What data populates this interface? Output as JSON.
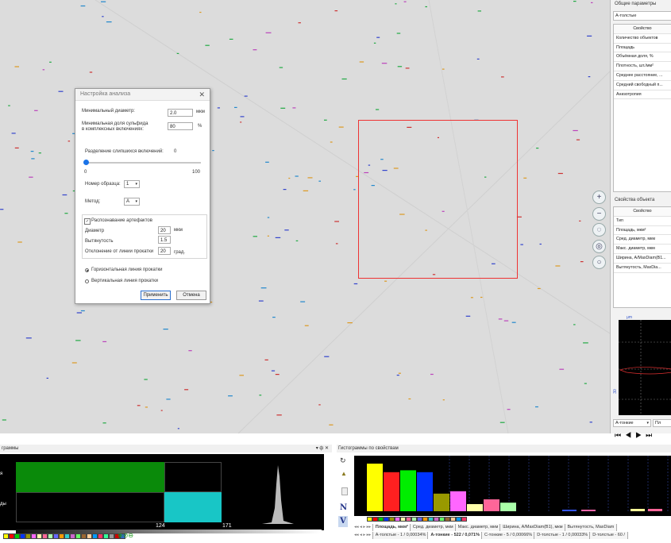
{
  "dialog": {
    "title": "Настройка анализа",
    "min_diameter_label": "Минимальный диаметр:",
    "min_diameter_value": "2.0",
    "min_diameter_unit": "мкм",
    "min_sulfide_label_1": "Минимальная доля сульфида",
    "min_sulfide_label_2": "в комплексных включениях:",
    "min_sulfide_value": "80",
    "min_sulfide_unit": "%",
    "split_label": "Разделение слипшихся включений:",
    "split_value": "0",
    "slider_min": "0",
    "slider_max": "100",
    "slider_fraction": 0.0,
    "sample_label": "Номер образца:",
    "sample_value": "1",
    "method_label": "Метод:",
    "method_value": "A",
    "artifacts_label": "Распознавание артефактов",
    "artifacts_checked": true,
    "diameter_label": "Диаметр",
    "diameter_value": "20",
    "diameter_unit": "мкм",
    "elong_label": "Вытянутость",
    "elong_value": "1.5",
    "deviation_label": "Отклонение от линии прокатки",
    "deviation_value": "20",
    "deviation_unit": "град.",
    "radio_horizontal": "Горизонтальная линия прокатки",
    "radio_vertical": "Вертикальная линия прокатки",
    "apply": "Применить",
    "cancel": "Отмена"
  },
  "right_panel": {
    "general_title": "Общие параметры",
    "category": "А-толстые",
    "table_header": "Свойство",
    "general_rows": [
      "Количество объектов",
      "Площадь",
      "Объёмная доля, %",
      "Плотность, шт./мм²",
      "Среднее расстояние, ...",
      "Средний свободный п...",
      "Анизотропия"
    ],
    "object_title": "Свойства объекта",
    "object_header": "Свойство",
    "object_rows": [
      "Тип",
      "Площадь, мкм²",
      "Сред. диаметр, мкм",
      "Макс. диаметр, мкм",
      "Ширина, A/MaxDiam(B1...",
      "Вытянутость, MaxDia..."
    ],
    "plot_axis_label": "μm",
    "plot_tick": "30",
    "dropdown_value": "А-тонкие",
    "dropdown2_value": "Пл"
  },
  "bottom_left": {
    "title": "граммы",
    "label_a": "я",
    "label_b": "ды",
    "tick1": "124",
    "tick2": "171",
    "pin": "▾ ф ✕"
  },
  "bottom_right": {
    "title": "Гистограммы по свойствам",
    "tabs_top": [
      "Площадь, мкм²",
      "Сред. диаметр, мкм",
      "Макс. диаметр, мкм",
      "Ширина, A/MaxDiam(B1), мкм",
      "Вытянутость, MaxDiam"
    ],
    "tabs_bottom": [
      "А-толстые - 1 / 0,00034%",
      "А-тонкие - 522 / 0,071%",
      "С-тонкие - 5 / 0,00066%",
      "D-толстые - 1 / 0,00033%",
      "D-толстые - 60 /"
    ],
    "tool_n": "N",
    "tool_v": "V"
  },
  "colors": {
    "roi": "#ee3333",
    "hist_green": "#0a8a0a",
    "hist_cyan": "#18c6c6",
    "bar_yellow": "#ffff00",
    "bar_red": "#ff0000",
    "bar_green": "#00ff00",
    "bar_blue": "#0033ff"
  },
  "histogram_bars": [
    {
      "color": "#ffff00",
      "value": 100
    },
    {
      "color": "#ff2020",
      "value": 82
    },
    {
      "color": "#00ee00",
      "value": 86
    },
    {
      "color": "#0033ff",
      "value": 82
    },
    {
      "color": "#999900",
      "value": 37
    },
    {
      "color": "#ff66ff",
      "value": 42
    },
    {
      "color": "#ffffaa",
      "value": 15
    },
    {
      "color": "#ff6699",
      "value": 25
    },
    {
      "color": "#aaffaa",
      "value": 18
    }
  ]
}
